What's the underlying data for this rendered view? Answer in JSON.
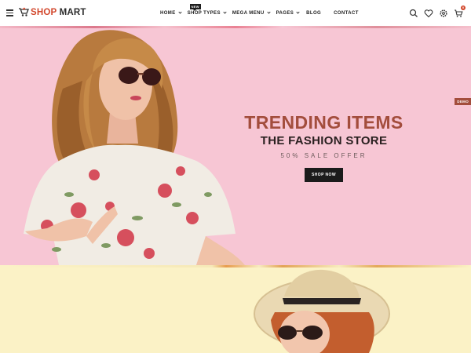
{
  "header": {
    "menu_icon": "hamburger-icon",
    "logo": {
      "part1": "Shop",
      "part2": "Mart",
      "icon": "shopping-cart-logo"
    },
    "nav": [
      {
        "label": "HOME",
        "has_dropdown": true
      },
      {
        "label": "SHOP TYPES",
        "has_dropdown": true,
        "badge": "NEW"
      },
      {
        "label": "MEGA MENU",
        "has_dropdown": true
      },
      {
        "label": "PAGES",
        "has_dropdown": true
      },
      {
        "label": "BLOG",
        "has_dropdown": false
      },
      {
        "label": "CONTACT",
        "has_dropdown": false
      }
    ],
    "icons": [
      "search-icon",
      "heart-icon",
      "settings-icon",
      "cart-icon"
    ],
    "cart_count": "0"
  },
  "hero": {
    "title": "TRENDING ITEMS",
    "subtitle": "THE FASHION STORE",
    "offer": "50% SALE OFFER",
    "button": "SHOP NOW",
    "demo_tab": "DEMO",
    "image": "woman-in-floral-dress-sunglasses"
  },
  "banner2": {
    "image": "woman-with-straw-hat-sunglasses"
  },
  "colors": {
    "accent": "#a34d3c",
    "logo_red": "#d2472c",
    "hero_bg": "#f7c6d4",
    "banner2_bg": "#fbf2c6"
  }
}
